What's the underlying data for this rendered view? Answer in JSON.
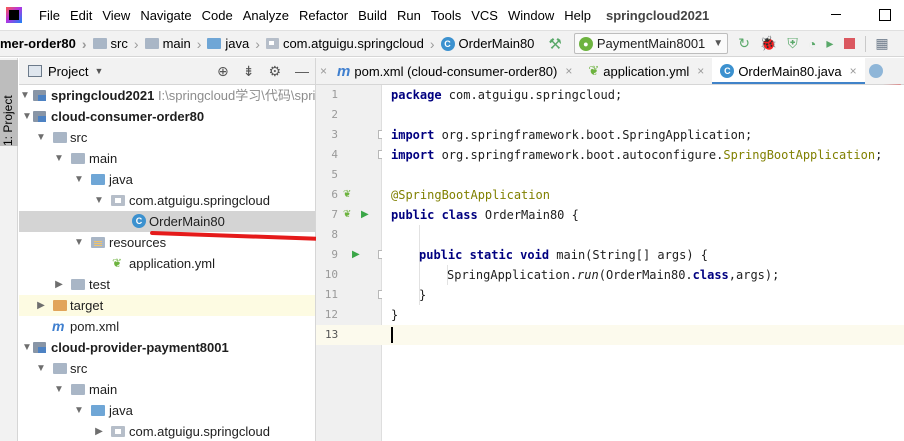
{
  "menubar": {
    "items": [
      "File",
      "Edit",
      "View",
      "Navigate",
      "Code",
      "Analyze",
      "Refactor",
      "Build",
      "Run",
      "Tools",
      "VCS",
      "Window",
      "Help"
    ],
    "project_title": "springcloud2021"
  },
  "navbar": {
    "crumbs": [
      "mer-order80",
      "src",
      "main",
      "java",
      "com.atguigu.springcloud",
      "OrderMain80"
    ],
    "run_config": "PaymentMain8001"
  },
  "side_stripe": {
    "label": "1: Project"
  },
  "project_panel": {
    "title": "Project",
    "rows": [
      {
        "label": "springcloud2021",
        "extra": "I:\\springcloud学习\\代码\\springc"
      },
      {
        "label": "cloud-consumer-order80"
      },
      {
        "label": "src"
      },
      {
        "label": "main"
      },
      {
        "label": "java"
      },
      {
        "label": "com.atguigu.springcloud"
      },
      {
        "label": "OrderMain80"
      },
      {
        "label": "resources"
      },
      {
        "label": "application.yml"
      },
      {
        "label": "test"
      },
      {
        "label": "target"
      },
      {
        "label": "pom.xml"
      },
      {
        "label": "cloud-provider-payment8001"
      },
      {
        "label": "src"
      },
      {
        "label": "main"
      },
      {
        "label": "java"
      },
      {
        "label": "com.atguigu.springcloud"
      }
    ]
  },
  "editor_tabs": [
    {
      "label": "pom.xml (cloud-consumer-order80)"
    },
    {
      "label": "application.yml"
    },
    {
      "label": "OrderMain80.java",
      "active": true
    }
  ],
  "editor": {
    "line_numbers": [
      "1",
      "2",
      "3",
      "4",
      "5",
      "6",
      "7",
      "8",
      "9",
      "10",
      "11",
      "12",
      "13"
    ],
    "code": {
      "l1_kw": "package",
      "l1_rest": " com.atguigu.springcloud;",
      "l3_kw": "import",
      "l3_rest": " org.springframework.boot.SpringApplication;",
      "l4_kw": "import",
      "l4_rest": " org.springframework.boot.autoconfigure.",
      "l4_ann": "SpringBootApplication",
      "l4_end": ";",
      "l6_ann": "@SpringBootApplication",
      "l7_kw": "public class",
      "l7_rest": " OrderMain80 {",
      "l9_kw": "public static void",
      "l9_rest": " main(String[] args) {",
      "l10_a": "SpringApplication.",
      "l10_it": "run",
      "l10_b": "(OrderMain80.",
      "l10_kw": "class",
      "l10_c": ",args);",
      "l11": "}",
      "l12": "}"
    }
  }
}
